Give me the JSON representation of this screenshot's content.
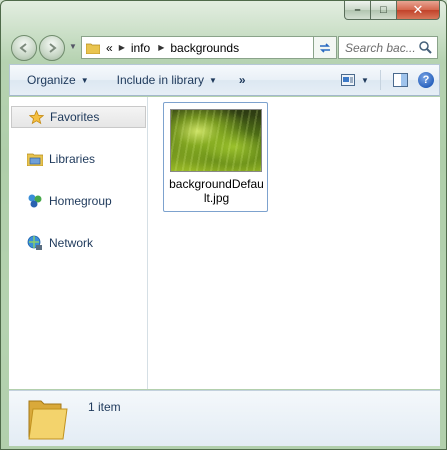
{
  "window": {
    "controls": {
      "minimize": "–",
      "maximize": "□",
      "close": "✕"
    }
  },
  "nav": {
    "back_icon": "arrow-left-icon",
    "forward_icon": "arrow-right-icon",
    "breadcrumb": {
      "overflow": "«",
      "items": [
        "info",
        "backgrounds"
      ]
    },
    "refresh_icon": "refresh-icon",
    "search_placeholder": "Search bac..."
  },
  "toolbar": {
    "organize": "Organize",
    "include_in_library": "Include in library",
    "more": "»",
    "view_icon": "view-options-icon",
    "preview_pane_icon": "preview-pane-icon",
    "help": "?"
  },
  "sidebar": {
    "items": [
      {
        "label": "Favorites",
        "icon": "star-icon",
        "selected": true
      },
      {
        "label": "Libraries",
        "icon": "libraries-icon",
        "selected": false
      },
      {
        "label": "Homegroup",
        "icon": "homegroup-icon",
        "selected": false
      },
      {
        "label": "Network",
        "icon": "network-icon",
        "selected": false
      }
    ]
  },
  "files": [
    {
      "name": "backgroundDefault.jpg",
      "type": "image",
      "selected": true
    }
  ],
  "details": {
    "item_count": "1 item",
    "icon": "folder-icon"
  },
  "colors": {
    "text_primary": "#1e395b",
    "selection_border": "#7da2ce",
    "close_button": "#c1422a"
  }
}
